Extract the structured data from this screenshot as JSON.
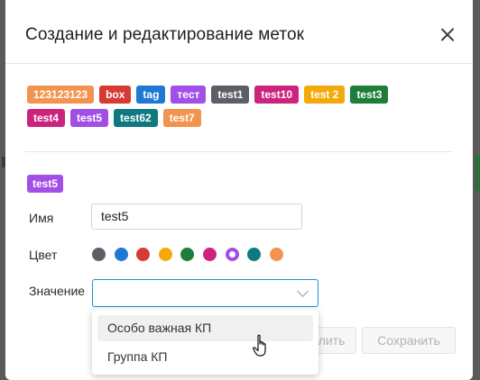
{
  "modal": {
    "title": "Создание и редактирование меток"
  },
  "tags": [
    {
      "label": "123123123",
      "color": "#f2944f"
    },
    {
      "label": "box",
      "color": "#d73a35"
    },
    {
      "label": "tag",
      "color": "#1f78d1"
    },
    {
      "label": "тест",
      "color": "#a24fe8"
    },
    {
      "label": "test1",
      "color": "#5e5e66"
    },
    {
      "label": "test10",
      "color": "#cc237f"
    },
    {
      "label": "test 2",
      "color": "#f4a90b"
    },
    {
      "label": "test3",
      "color": "#1e7d3a"
    },
    {
      "label": "test4",
      "color": "#cc237f"
    },
    {
      "label": "test5",
      "color": "#a24fe8"
    },
    {
      "label": "test62",
      "color": "#0e7a80"
    },
    {
      "label": "test7",
      "color": "#f2944f"
    }
  ],
  "editor": {
    "selected_tag": {
      "label": "test5",
      "color": "#a24fe8"
    },
    "name_label": "Имя",
    "name_value": "test5",
    "color_label": "Цвет",
    "colors": [
      {
        "name": "gray",
        "hex": "#5e5e66",
        "selected": false
      },
      {
        "name": "blue",
        "hex": "#1f78d1",
        "selected": false
      },
      {
        "name": "red",
        "hex": "#d73a35",
        "selected": false
      },
      {
        "name": "yellow",
        "hex": "#f4a90b",
        "selected": false
      },
      {
        "name": "green",
        "hex": "#1e7d3a",
        "selected": false
      },
      {
        "name": "magenta",
        "hex": "#cc237f",
        "selected": false
      },
      {
        "name": "purple",
        "hex": "#a24fe8",
        "selected": true
      },
      {
        "name": "teal",
        "hex": "#0e7a80",
        "selected": false
      },
      {
        "name": "orange",
        "hex": "#f2944f",
        "selected": false
      }
    ],
    "value_label": "Значение",
    "value_selected": ""
  },
  "dropdown": {
    "options": [
      "Особо важная КП",
      "Группа КП"
    ]
  },
  "buttons": {
    "cancel_label": "Удалить",
    "save_label": "Сохранить"
  }
}
